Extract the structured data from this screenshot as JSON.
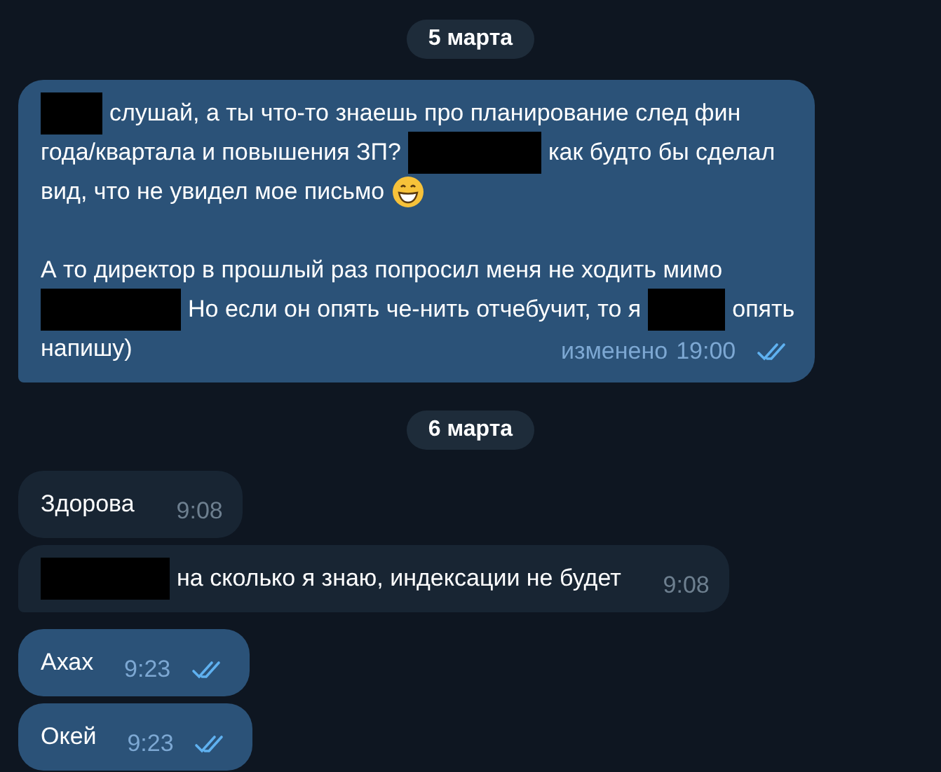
{
  "messages": [
    {
      "kind": "date",
      "text": "5 марта"
    },
    {
      "kind": "message",
      "outgoing": true,
      "paragraphs": [
        [
          [
            {
              "kind": "redacted"
            },
            {
              "kind": "text",
              "text": "слушай, а ты что-то знаешь про планирование след фин"
            }
          ],
          [
            {
              "kind": "text",
              "text": "года/квартала и повышения ЗП?"
            },
            {
              "kind": "redacted"
            },
            {
              "kind": "text",
              "text": "как будто бы сделал"
            }
          ],
          [
            {
              "kind": "text",
              "text": "вид, что не увидел мое письмо"
            },
            {
              "kind": "emoji"
            }
          ]
        ],
        [
          [
            {
              "kind": "text",
              "text": "А то директор в прошлый раз попросил меня не ходить мимо"
            }
          ],
          [
            {
              "kind": "redacted"
            },
            {
              "kind": "text",
              "text": "Но если он опять че-нить отчебучит, то я"
            },
            {
              "kind": "redacted"
            },
            {
              "kind": "text",
              "text": "опять"
            }
          ],
          [
            {
              "kind": "text",
              "text": "напишу)"
            }
          ]
        ]
      ],
      "edited": "изменено",
      "time": "19:00",
      "read": true,
      "tail": true
    },
    {
      "kind": "date",
      "text": "6 марта"
    },
    {
      "kind": "message",
      "outgoing": false,
      "paragraphs": [
        [
          [
            {
              "kind": "text",
              "text": "Здорова"
            }
          ]
        ]
      ],
      "time": "9:08",
      "tail": false
    },
    {
      "kind": "message",
      "outgoing": false,
      "paragraphs": [
        [
          [
            {
              "kind": "redacted"
            },
            {
              "kind": "text",
              "text": "на сколько я знаю, индексации не будет"
            }
          ]
        ]
      ],
      "time": "9:08",
      "tail": true
    },
    {
      "kind": "message",
      "outgoing": true,
      "paragraphs": [
        [
          [
            {
              "kind": "text",
              "text": "Ахах"
            }
          ]
        ]
      ],
      "time": "9:23",
      "read": true,
      "tail": false
    },
    {
      "kind": "message",
      "outgoing": true,
      "paragraphs": [
        [
          [
            {
              "kind": "text",
              "text": "Окей"
            }
          ]
        ]
      ],
      "time": "9:23",
      "read": true,
      "tail": false
    }
  ]
}
